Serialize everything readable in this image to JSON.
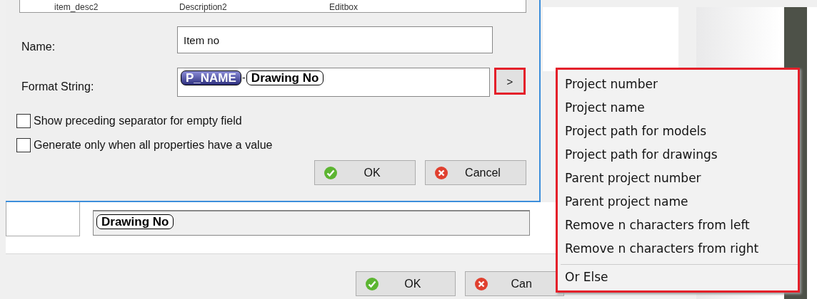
{
  "parent_dialog": {
    "tokens": [
      {
        "text": "Drawing No",
        "kind": "property"
      }
    ],
    "buttons": [
      {
        "label": "OK",
        "kind": "ok"
      },
      {
        "label": "Can",
        "kind": "cancel"
      }
    ]
  },
  "dialog": {
    "table_row": [
      "item_desc2",
      "Description2",
      "Editbox"
    ],
    "name": {
      "label": "Name:",
      "value": "Item no"
    },
    "format_string": {
      "label": "Format String:",
      "tokens": [
        {
          "text": "P_NAME",
          "kind": "variable"
        },
        {
          "text": "-",
          "kind": "separator"
        },
        {
          "text": "Drawing No",
          "kind": "property"
        }
      ],
      "insert_button": {
        "label": ">",
        "highlighted": true
      }
    },
    "checkboxes": [
      {
        "label": "Show preceding separator for empty field",
        "checked": false
      },
      {
        "label": "Generate only when all properties have a value",
        "checked": false
      }
    ],
    "buttons": [
      {
        "label": "OK",
        "kind": "ok"
      },
      {
        "label": "Cancel",
        "kind": "cancel"
      }
    ]
  },
  "insert_menu": {
    "highlighted": true,
    "items": [
      {
        "label": "Project number"
      },
      {
        "label": "Project name"
      },
      {
        "label": "Project path for models"
      },
      {
        "label": "Project path for drawings"
      },
      {
        "label": "Parent project number"
      },
      {
        "label": "Parent project name"
      },
      {
        "label": "Remove n characters from left"
      },
      {
        "label": "Remove n characters from right"
      }
    ],
    "footer_items": [
      {
        "label": "Or Else"
      }
    ]
  }
}
